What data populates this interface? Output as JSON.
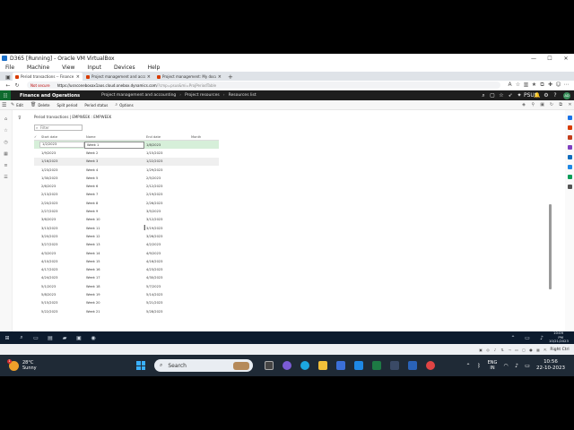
{
  "vbox": {
    "title": "D365 [Running] - Oracle VM VirtualBox",
    "menu": [
      "File",
      "Machine",
      "View",
      "Input",
      "Devices",
      "Help"
    ]
  },
  "browser": {
    "tabs": [
      {
        "label": "Period transactions -- Finance a...",
        "active": true
      },
      {
        "label": "Project management and accou...",
        "active": false
      },
      {
        "label": "Project management: My docum...",
        "active": false
      }
    ],
    "address": {
      "security": "Not secure",
      "domain": "https://usnconeboxax1aos.cloud.onebox.dynamics.com",
      "path": "/?cmp=psus&mi=ProjPeriodTable"
    }
  },
  "d365": {
    "app_name": "Finance and Operations",
    "breadcrumb_top": [
      "Project management and accounting",
      "Project resources",
      "Resources list"
    ],
    "company": "PSUS",
    "user_initials": "AD"
  },
  "actions": {
    "items": [
      "Edit",
      "Delete",
      "Split period",
      "Period status",
      "Options"
    ]
  },
  "page": {
    "breadcrumb": "Period transactions  |  EMPWEEK : EMPWEEK",
    "filter_placeholder": "Filter"
  },
  "grid": {
    "columns": [
      "Start date",
      "Name",
      "End date",
      "Month"
    ],
    "rows": [
      {
        "start": "1/2/2023",
        "name": "Week 1",
        "end": "1/8/2023"
      },
      {
        "start": "1/9/2023",
        "name": "Week 2",
        "end": "1/15/2023"
      },
      {
        "start": "1/16/2023",
        "name": "Week 3",
        "end": "1/22/2023"
      },
      {
        "start": "1/23/2023",
        "name": "Week 4",
        "end": "1/29/2023"
      },
      {
        "start": "1/30/2023",
        "name": "Week 5",
        "end": "2/5/2023"
      },
      {
        "start": "2/6/2023",
        "name": "Week 6",
        "end": "2/12/2023"
      },
      {
        "start": "2/13/2023",
        "name": "Week 7",
        "end": "2/19/2023"
      },
      {
        "start": "2/20/2023",
        "name": "Week 8",
        "end": "2/26/2023"
      },
      {
        "start": "2/27/2023",
        "name": "Week 9",
        "end": "3/5/2023"
      },
      {
        "start": "3/6/2023",
        "name": "Week 10",
        "end": "3/12/2023"
      },
      {
        "start": "3/13/2023",
        "name": "Week 11",
        "end": "3/19/2023"
      },
      {
        "start": "3/20/2023",
        "name": "Week 12",
        "end": "3/26/2023"
      },
      {
        "start": "3/27/2023",
        "name": "Week 13",
        "end": "4/2/2023"
      },
      {
        "start": "4/3/2023",
        "name": "Week 14",
        "end": "4/9/2023"
      },
      {
        "start": "4/10/2023",
        "name": "Week 15",
        "end": "4/16/2023"
      },
      {
        "start": "4/17/2023",
        "name": "Week 16",
        "end": "4/23/2023"
      },
      {
        "start": "4/24/2023",
        "name": "Week 17",
        "end": "4/30/2023"
      },
      {
        "start": "5/1/2023",
        "name": "Week 18",
        "end": "5/7/2023"
      },
      {
        "start": "5/8/2023",
        "name": "Week 19",
        "end": "5/14/2023"
      },
      {
        "start": "5/15/2023",
        "name": "Week 20",
        "end": "5/21/2023"
      },
      {
        "start": "5/22/2023",
        "name": "Week 21",
        "end": "5/28/2023"
      }
    ]
  },
  "vm_taskbar": {
    "time": "10:09 PM",
    "date": "10/21/2023"
  },
  "vb_status": {
    "host_key": "Right Ctrl"
  },
  "host": {
    "weather_temp": "28°C",
    "weather_desc": "Sunny",
    "weather_badge": "1",
    "search_label": "Search",
    "lang_top": "ENG",
    "lang_bottom": "IN",
    "time": "10:56",
    "date": "22-10-2023"
  }
}
